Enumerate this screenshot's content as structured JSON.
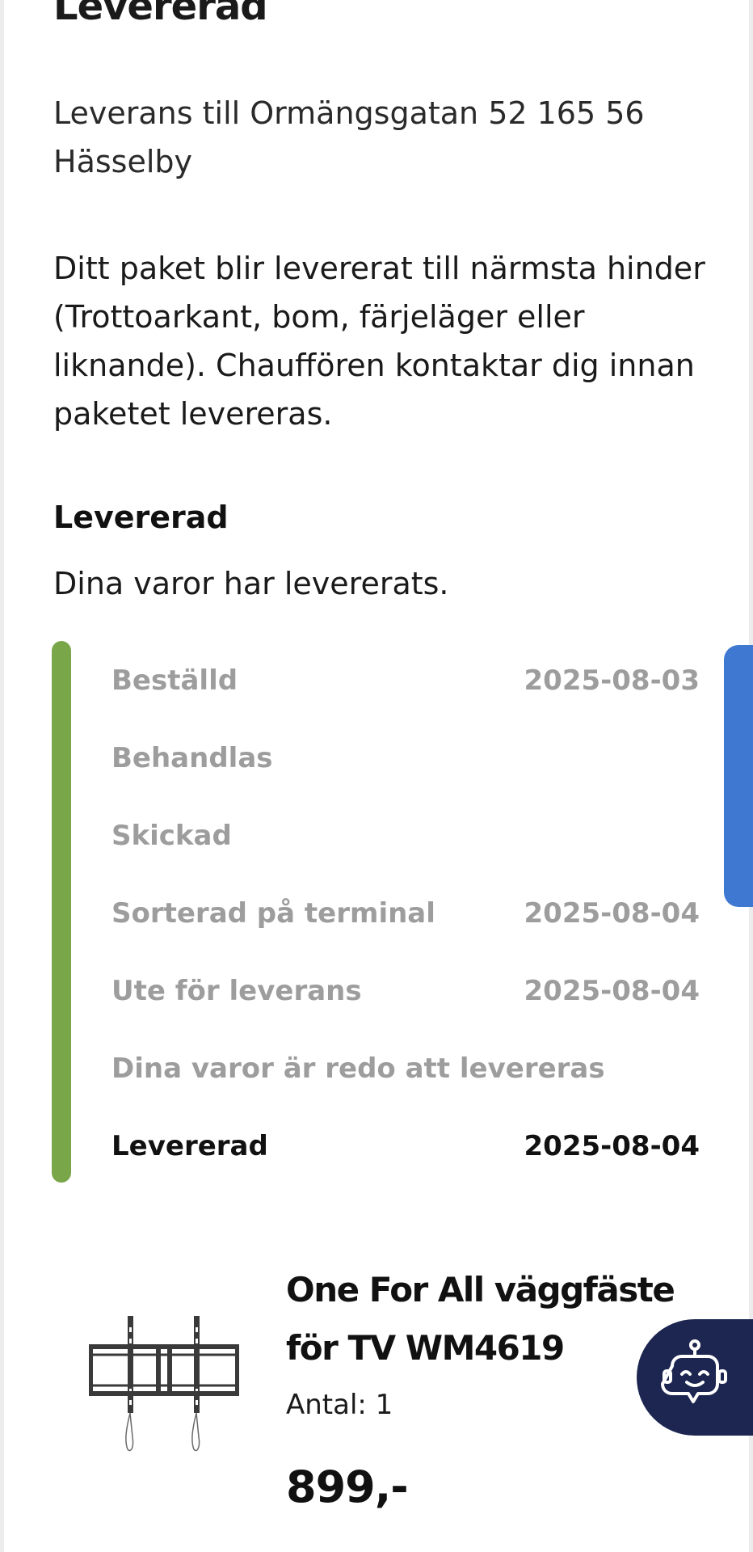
{
  "delivery": {
    "title": "Levererad",
    "address": "Leverans till Ormängsgatan 52 165 56 Hässelby",
    "info": "Ditt paket blir levererat till närmsta hinder (Trottoarkant, bom, färjeläger eller liknande). Chauffören kontaktar dig innan paketet levereras."
  },
  "status": {
    "heading": "Levererad",
    "description": "Dina varor har levererats.",
    "progress_color": "#7aa64a",
    "steps": [
      {
        "label": "Beställd",
        "date": "2025-08-03"
      },
      {
        "label": "Behandlas",
        "date": ""
      },
      {
        "label": "Skickad",
        "date": ""
      },
      {
        "label": "Sorterad på terminal",
        "date": "2025-08-04"
      },
      {
        "label": "Ute för leverans",
        "date": "2025-08-04"
      },
      {
        "label": "Dina varor är redo att levereras",
        "date": ""
      },
      {
        "label": "Levererad",
        "date": "2025-08-04"
      }
    ]
  },
  "product": {
    "name": "One For All väggfäste för TV WM4619",
    "quantity": "Antal: 1",
    "price": "899,-",
    "image_icon": "tv-wall-mount-image"
  },
  "chatbot": {
    "icon": "chatbot-robot-icon",
    "color": "#1c2650"
  },
  "scroll_tab_color": "#3f78d1"
}
